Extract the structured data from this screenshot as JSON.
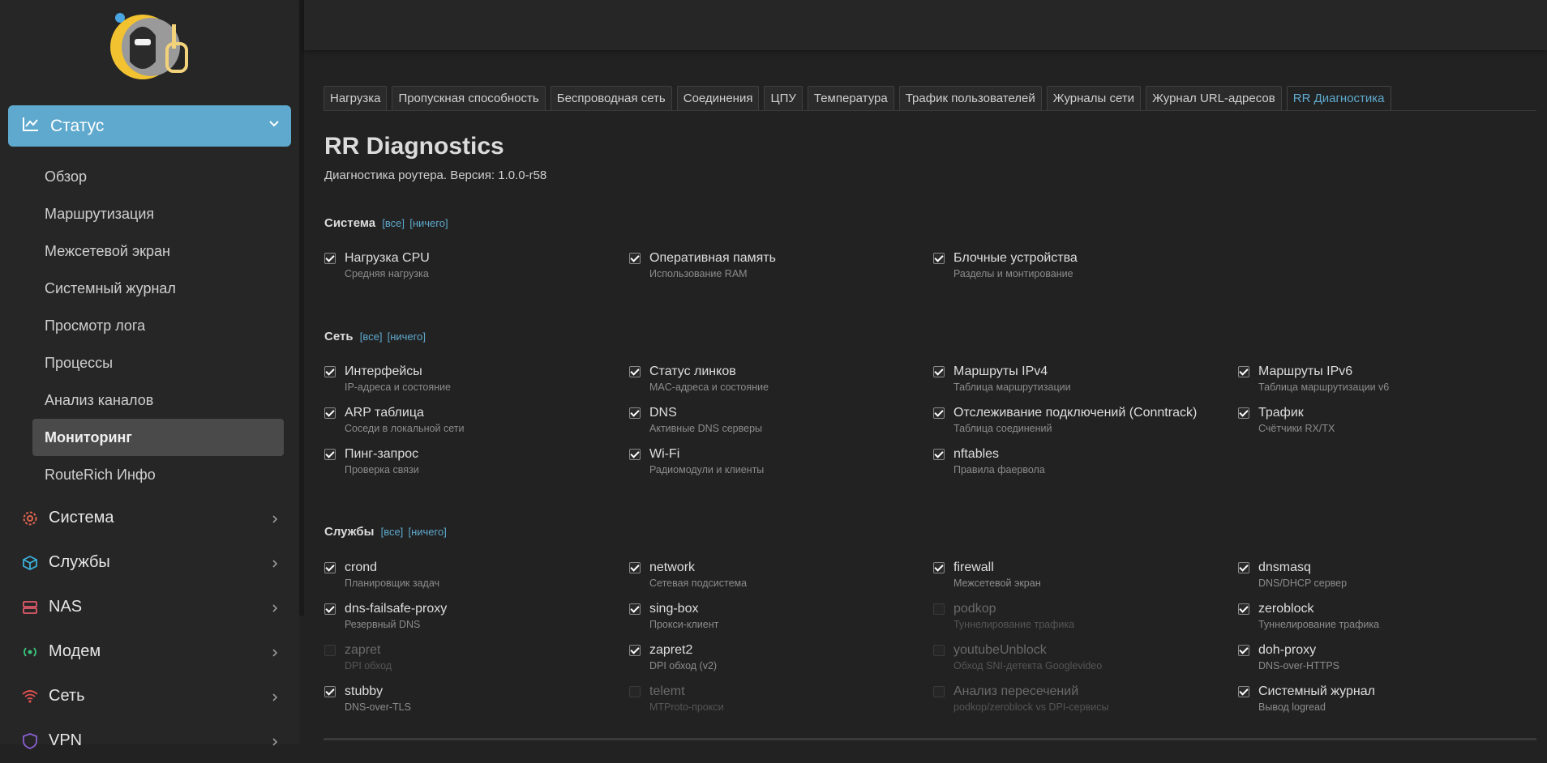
{
  "sidebar": {
    "status_label": "Статус",
    "subitems": [
      "Обзор",
      "Маршрутизация",
      "Межсетевой экран",
      "Системный журнал",
      "Просмотр лога",
      "Процессы",
      "Анализ каналов",
      "Мониторинг",
      "RouteRich Инфо"
    ],
    "active_subitem": "Мониторинг",
    "groups": [
      {
        "label": "Система",
        "icon": "gear-icon",
        "color": "#e0644f"
      },
      {
        "label": "Службы",
        "icon": "cube-icon",
        "color": "#3bb0d8"
      },
      {
        "label": "NAS",
        "icon": "server-icon",
        "color": "#e05a6a"
      },
      {
        "label": "Модем",
        "icon": "broadcast-icon",
        "color": "#39c27a"
      },
      {
        "label": "Сеть",
        "icon": "wifi-icon",
        "color": "#e05050"
      },
      {
        "label": "VPN",
        "icon": "shield-icon",
        "color": "#8a5fd0"
      }
    ]
  },
  "tabs": [
    "Нагрузка",
    "Пропускная способность",
    "Беспроводная сеть",
    "Соединения",
    "ЦПУ",
    "Температура",
    "Трафик пользователей",
    "Журналы сети",
    "Журнал URL-адресов",
    "RR Диагностика"
  ],
  "active_tab": "RR Диагностика",
  "page": {
    "title": "RR Diagnostics",
    "subtitle": "Диагностика роутера. Версия: 1.0.0-r58",
    "all_link": "[все]",
    "none_link": "[ничего]"
  },
  "sections": {
    "system": {
      "title": "Система",
      "items": [
        {
          "name": "Нагрузка CPU",
          "desc": "Средняя нагрузка",
          "checked": true
        },
        {
          "name": "Оперативная память",
          "desc": "Использование RAM",
          "checked": true
        },
        {
          "name": "Блочные устройства",
          "desc": "Разделы и монтирование",
          "checked": true
        }
      ]
    },
    "network": {
      "title": "Сеть",
      "items": [
        {
          "name": "Интерфейсы",
          "desc": "IP-адреса и состояние",
          "checked": true
        },
        {
          "name": "Статус линков",
          "desc": "MAC-адреса и состояние",
          "checked": true
        },
        {
          "name": "Маршруты IPv4",
          "desc": "Таблица маршрутизации",
          "checked": true
        },
        {
          "name": "Маршруты IPv6",
          "desc": "Таблица маршрутизации v6",
          "checked": true
        },
        {
          "name": "ARP таблица",
          "desc": "Соседи в локальной сети",
          "checked": true
        },
        {
          "name": "DNS",
          "desc": "Активные DNS серверы",
          "checked": true
        },
        {
          "name": "Отслеживание подключений (Conntrack)",
          "desc": "Таблица соединений",
          "checked": true
        },
        {
          "name": "Трафик",
          "desc": "Счётчики RX/TX",
          "checked": true
        },
        {
          "name": "Пинг-запрос",
          "desc": "Проверка связи",
          "checked": true
        },
        {
          "name": "Wi-Fi",
          "desc": "Радиомодули и клиенты",
          "checked": true
        },
        {
          "name": "nftables",
          "desc": "Правила фаервола",
          "checked": true
        }
      ]
    },
    "services": {
      "title": "Службы",
      "items": [
        {
          "name": "crond",
          "desc": "Планировщик задач",
          "checked": true
        },
        {
          "name": "network",
          "desc": "Сетевая подсистема",
          "checked": true
        },
        {
          "name": "firewall",
          "desc": "Межсетевой экран",
          "checked": true
        },
        {
          "name": "dnsmasq",
          "desc": "DNS/DHCP сервер",
          "checked": true
        },
        {
          "name": "dns-failsafe-proxy",
          "desc": "Резервный DNS",
          "checked": true
        },
        {
          "name": "sing-box",
          "desc": "Прокси-клиент",
          "checked": true
        },
        {
          "name": "podkop",
          "desc": "Туннелирование трафика",
          "checked": false
        },
        {
          "name": "zeroblock",
          "desc": "Туннелирование трафика",
          "checked": true
        },
        {
          "name": "zapret",
          "desc": "DPI обход",
          "checked": false
        },
        {
          "name": "zapret2",
          "desc": "DPI обход (v2)",
          "checked": true
        },
        {
          "name": "youtubeUnblock",
          "desc": "Обход SNI-детекта Googlevideo",
          "checked": false
        },
        {
          "name": "doh-proxy",
          "desc": "DNS-over-HTTPS",
          "checked": true
        },
        {
          "name": "stubby",
          "desc": "DNS-over-TLS",
          "checked": true
        },
        {
          "name": "telemt",
          "desc": "MTProto-прокси",
          "checked": false
        },
        {
          "name": "Анализ пересечений",
          "desc": "podkop/zeroblock vs DPI-сервисы",
          "checked": false
        },
        {
          "name": "Системный журнал",
          "desc": "Вывод logread",
          "checked": true
        }
      ]
    }
  }
}
